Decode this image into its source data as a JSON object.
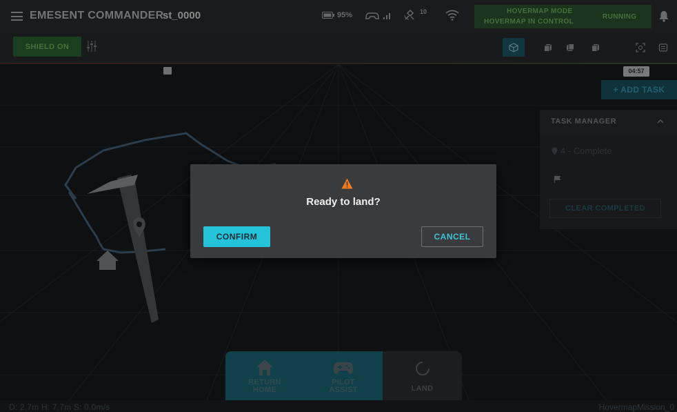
{
  "header": {
    "app_title": "EMESENT COMMANDER",
    "station_id": "st_0000",
    "battery_label": "95%",
    "satellite_count": "10",
    "mode_line1": "HOVERMAP MODE",
    "mode_line2": "HOVERMAP IN CONTROL",
    "run_status": "RUNNING",
    "mode_color": "#2f5a35"
  },
  "toolbar": {
    "shield_label": "SHIELD ON",
    "view_buttons": [
      "3d-view",
      "front-view",
      "side-view",
      "top-view",
      "focus-view",
      "info-view"
    ]
  },
  "viewport": {
    "timer": "04:57",
    "add_task_label": "+ ADD TASK"
  },
  "task_manager": {
    "title": "TASK MANAGER",
    "item_label": "4 - Complete",
    "clear_label": "CLEAR COMPLETED"
  },
  "bottom_controls": {
    "return_home_line1": "RETURN",
    "return_home_line2": "HOME",
    "pilot_assist_line1": "PILOT",
    "pilot_assist_line2": "ASSIST",
    "land_label": "LAND"
  },
  "status_bar": {
    "telemetry": "D: 2.7m   H: 7.7m   S: 0.0m/s",
    "mission": "HovermapMission_0"
  },
  "dialog": {
    "message": "Ready to land?",
    "confirm_label": "CONFIRM",
    "cancel_label": "CANCEL",
    "accent_color": "#25c3d9",
    "warning_color": "#f07d1a"
  }
}
